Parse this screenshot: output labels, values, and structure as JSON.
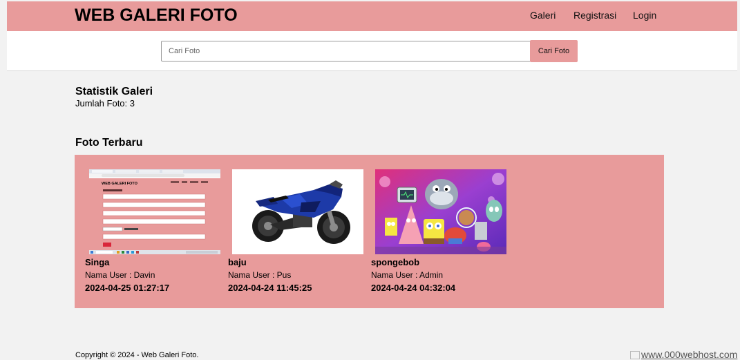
{
  "navbar": {
    "brand": "WEB GALERI FOTO",
    "links": [
      "Galeri",
      "Registrasi",
      "Login"
    ]
  },
  "search": {
    "placeholder": "Cari Foto",
    "button_label": "Cari Foto"
  },
  "stats": {
    "title": "Statistik Galeri",
    "count_text": "Jumlah Foto: 3"
  },
  "latest": {
    "title": "Foto Terbaru",
    "photos": [
      {
        "title": "Singa",
        "user": "Nama User : Davin",
        "date": "2024-04-25 01:27:17",
        "thumb_brand": "WEB GALERI FOTO"
      },
      {
        "title": "baju",
        "user": "Nama User : Pus",
        "date": "2024-04-24 11:45:25"
      },
      {
        "title": "spongebob",
        "user": "Nama User : Admin",
        "date": "2024-04-24 04:32:04"
      }
    ]
  },
  "footer": {
    "copyright": "Copyright © 2024 - Web Galeri Foto.",
    "host_badge": "www.000webhost.com"
  },
  "colors": {
    "accent": "#e89b9b",
    "background": "#f2f2f2"
  }
}
